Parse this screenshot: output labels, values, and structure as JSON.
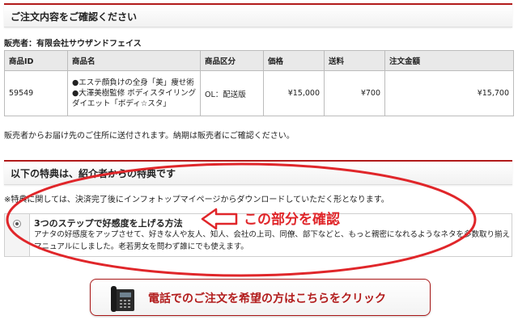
{
  "order_confirm": {
    "heading": "ご注文内容をご確認ください",
    "seller_line": "販売者：有限会社サウザンドフェイス",
    "columns": [
      "商品ID",
      "商品名",
      "商品区分",
      "価格",
      "送料",
      "注文金額"
    ],
    "rows": [
      {
        "product_id": "59549",
        "name_line1": "●エステ顔負けの全身「美」痩せ術",
        "name_line2": "●大澤美樹監修 ボディスタイリング",
        "name_line3": "ダイエット「ボディ☆スタ」",
        "category": "OL：配送版",
        "price": "¥15,000",
        "shipping": "¥700",
        "total": "¥15,700"
      }
    ],
    "delivery_note": "販売者からお届け先のご住所に送付されます。納期は販売者にご確認ください。"
  },
  "bonus": {
    "heading": "以下の特典は、紹介者からの特典です",
    "note": "※特典に関しては、決済完了後にインフォトップマイページからダウンロードしていただく形となります。",
    "item_title": "3つのステップで好感度を上げる方法",
    "item_desc": "アナタの好感度をアップさせて、好きな人や友人、知人、会社の上司、同僚、部下などと、もっと親密になれるようなネタを多数取り揃えマニュアルにしました。老若男女を問わず誰にでも使えます。"
  },
  "annotation": {
    "text": "この部分を確認",
    "color": "#e0262a"
  },
  "phone_button": {
    "label": "電話でのご注文を希望の方はこちらをクリック",
    "icon": "telephone-icon"
  },
  "colors": {
    "accent": "#b11a1a",
    "annotation_red": "#e0262a"
  }
}
